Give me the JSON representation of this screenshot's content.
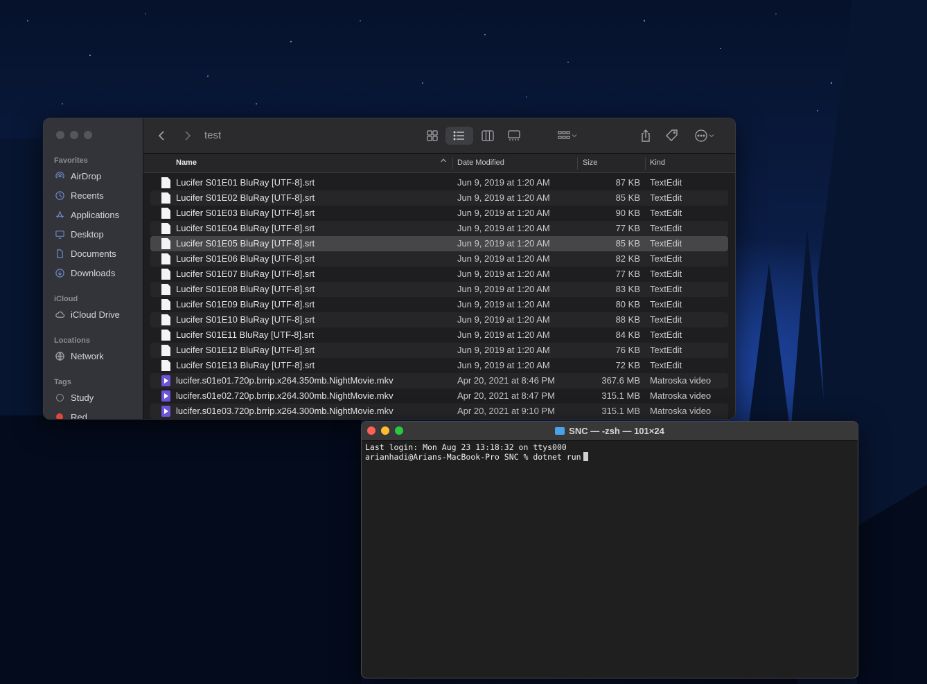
{
  "finder": {
    "title": "test",
    "sidebar": {
      "favorites_header": "Favorites",
      "favorites": [
        {
          "label": "AirDrop",
          "icon": "airdrop-icon"
        },
        {
          "label": "Recents",
          "icon": "clock-icon"
        },
        {
          "label": "Applications",
          "icon": "applications-icon"
        },
        {
          "label": "Desktop",
          "icon": "desktop-icon"
        },
        {
          "label": "Documents",
          "icon": "document-icon"
        },
        {
          "label": "Downloads",
          "icon": "download-icon"
        }
      ],
      "icloud_header": "iCloud",
      "icloud": [
        {
          "label": "iCloud Drive",
          "icon": "cloud-icon"
        }
      ],
      "locations_header": "Locations",
      "locations": [
        {
          "label": "Network",
          "icon": "globe-icon"
        }
      ],
      "tags_header": "Tags",
      "tags": [
        {
          "label": "Study",
          "color": "#8a8a8a"
        },
        {
          "label": "Red",
          "color": "#e0443e"
        }
      ]
    },
    "columns": {
      "name": "Name",
      "date": "Date Modified",
      "size": "Size",
      "kind": "Kind"
    },
    "files": [
      {
        "name": "Lucifer S01E01 BluRay [UTF-8].srt",
        "date": "Jun 9, 2019 at 1:20 AM",
        "size": "87 KB",
        "kind": "TextEdit",
        "type": "doc"
      },
      {
        "name": "Lucifer S01E02 BluRay [UTF-8].srt",
        "date": "Jun 9, 2019 at 1:20 AM",
        "size": "85 KB",
        "kind": "TextEdit",
        "type": "doc"
      },
      {
        "name": "Lucifer S01E03 BluRay [UTF-8].srt",
        "date": "Jun 9, 2019 at 1:20 AM",
        "size": "90 KB",
        "kind": "TextEdit",
        "type": "doc"
      },
      {
        "name": "Lucifer S01E04 BluRay [UTF-8].srt",
        "date": "Jun 9, 2019 at 1:20 AM",
        "size": "77 KB",
        "kind": "TextEdit",
        "type": "doc"
      },
      {
        "name": "Lucifer S01E05 BluRay [UTF-8].srt",
        "date": "Jun 9, 2019 at 1:20 AM",
        "size": "85 KB",
        "kind": "TextEdit",
        "type": "doc",
        "selected": true
      },
      {
        "name": "Lucifer S01E06 BluRay [UTF-8].srt",
        "date": "Jun 9, 2019 at 1:20 AM",
        "size": "82 KB",
        "kind": "TextEdit",
        "type": "doc"
      },
      {
        "name": "Lucifer S01E07 BluRay [UTF-8].srt",
        "date": "Jun 9, 2019 at 1:20 AM",
        "size": "77 KB",
        "kind": "TextEdit",
        "type": "doc"
      },
      {
        "name": "Lucifer S01E08 BluRay [UTF-8].srt",
        "date": "Jun 9, 2019 at 1:20 AM",
        "size": "83 KB",
        "kind": "TextEdit",
        "type": "doc"
      },
      {
        "name": "Lucifer S01E09 BluRay [UTF-8].srt",
        "date": "Jun 9, 2019 at 1:20 AM",
        "size": "80 KB",
        "kind": "TextEdit",
        "type": "doc"
      },
      {
        "name": "Lucifer S01E10 BluRay [UTF-8].srt",
        "date": "Jun 9, 2019 at 1:20 AM",
        "size": "88 KB",
        "kind": "TextEdit",
        "type": "doc"
      },
      {
        "name": "Lucifer S01E11 BluRay [UTF-8].srt",
        "date": "Jun 9, 2019 at 1:20 AM",
        "size": "84 KB",
        "kind": "TextEdit",
        "type": "doc"
      },
      {
        "name": "Lucifer S01E12 BluRay [UTF-8].srt",
        "date": "Jun 9, 2019 at 1:20 AM",
        "size": "76 KB",
        "kind": "TextEdit",
        "type": "doc"
      },
      {
        "name": "Lucifer S01E13 BluRay [UTF-8].srt",
        "date": "Jun 9, 2019 at 1:20 AM",
        "size": "72 KB",
        "kind": "TextEdit",
        "type": "doc"
      },
      {
        "name": "lucifer.s01e01.720p.brrip.x264.350mb.NightMovie.mkv",
        "date": "Apr 20, 2021 at 8:46 PM",
        "size": "367.6 MB",
        "kind": "Matroska video",
        "type": "video"
      },
      {
        "name": "lucifer.s01e02.720p.brrip.x264.300mb.NightMovie.mkv",
        "date": "Apr 20, 2021 at 8:47 PM",
        "size": "315.1 MB",
        "kind": "Matroska video",
        "type": "video"
      },
      {
        "name": "lucifer.s01e03.720p.brrip.x264.300mb.NightMovie.mkv",
        "date": "Apr 20, 2021 at 9:10 PM",
        "size": "315.1 MB",
        "kind": "Matroska video",
        "type": "video"
      }
    ]
  },
  "terminal": {
    "title": "SNC — -zsh — 101×24",
    "line1": "Last login: Mon Aug 23 13:18:32 on ttys000",
    "line2": "arianhadi@Arians-MacBook-Pro SNC % dotnet run"
  }
}
